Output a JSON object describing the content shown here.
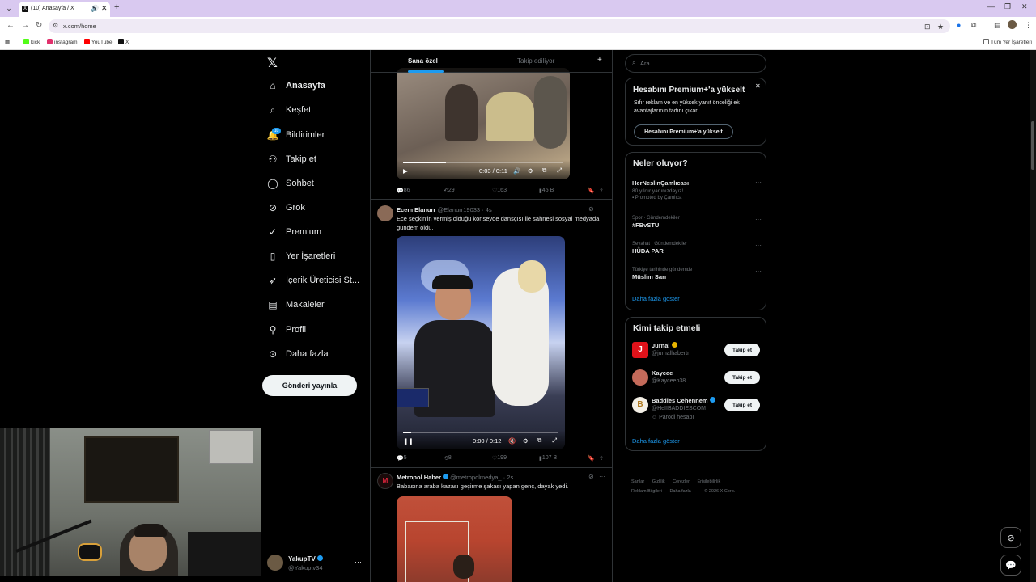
{
  "browser": {
    "tab_title": "(10) Anasayfa / X",
    "url": "x.com/home",
    "bookmarks": [
      "kick",
      "instagram",
      "YouTube",
      "X"
    ],
    "all_bookmarks": "Tüm Yer İşaretleri"
  },
  "nav": {
    "items": [
      {
        "label": "Anasayfa",
        "icon": "home-icon"
      },
      {
        "label": "Keşfet",
        "icon": "search-icon"
      },
      {
        "label": "Bildirimler",
        "icon": "bell-icon"
      },
      {
        "label": "Takip et",
        "icon": "follow-icon"
      },
      {
        "label": "Sohbet",
        "icon": "chat-icon"
      },
      {
        "label": "Grok",
        "icon": "grok-icon"
      },
      {
        "label": "Premium",
        "icon": "premium-icon"
      },
      {
        "label": "Yer İşaretleri",
        "icon": "bookmark-icon"
      },
      {
        "label": "İçerik Üreticisi St...",
        "icon": "rocket-icon"
      },
      {
        "label": "Makaleler",
        "icon": "article-icon"
      },
      {
        "label": "Profil",
        "icon": "person-icon"
      },
      {
        "label": "Daha fazla",
        "icon": "more-icon"
      }
    ],
    "notification_count": "10",
    "post_button": "Gönderi yayınla",
    "profile": {
      "name": "YakupTV",
      "handle": "@Yakuptv34"
    }
  },
  "feed": {
    "tabs": [
      "Sana özel",
      "Takip ediliyor"
    ],
    "tweet1": {
      "video_time": "0:03 / 0:11",
      "video_progress": 0.27,
      "replies": "86",
      "retweets": "29",
      "likes": "163",
      "views": "45 B"
    },
    "tweet2": {
      "name": "Ecem Elanurr",
      "handle": "@Elanurr19033",
      "time": "· 4s",
      "text": "Ece seçkin'in vermiş olduğu konseyde dansçısı ile sahnesi sosyal medyada gündem oldu.",
      "video_time": "0:00 / 0:12",
      "video_progress": 0.05,
      "replies": "5",
      "retweets": "8",
      "likes": "199",
      "views": "107 B"
    },
    "tweet3": {
      "name": "Metropol Haber",
      "handle": "@metropolmedya_",
      "time": "· 2s",
      "text": "Babasına araba kazası geçirme şakası yapan genç, dayak yedi."
    }
  },
  "sidebar": {
    "search_placeholder": "Ara",
    "premium": {
      "title": "Hesabını Premium+'a yükselt",
      "desc": "Sıfır reklam ve en yüksek yanıt önceliği ek avantajlarının tadını çıkar.",
      "button": "Hesabını Premium+'a yükselt"
    },
    "trends_title": "Neler oluyor?",
    "trends": [
      {
        "meta": "",
        "name": "HerNeslinÇamlıcası",
        "sub": "80 yıldır yanınızdayız!",
        "promo": "Promoted by Çamlıca"
      },
      {
        "meta": "Spor · Gündemdekiler",
        "name": "#FBvSTU"
      },
      {
        "meta": "Seyahat · Gündemdekiler",
        "name": "HÜDA PAR"
      },
      {
        "meta": "Türkiye tarihinde gündemde",
        "name": "Müslim Sarı"
      }
    ],
    "show_more": "Daha fazla göster",
    "wtf_title": "Kimi takip etmeli",
    "wtf": [
      {
        "name": "Jurnal",
        "handle": "@jurnalhabertr",
        "badge": "gold"
      },
      {
        "name": "Kaycee",
        "handle": "@Kayceep38",
        "badge": ""
      },
      {
        "name": "Baddies Cehennem",
        "handle": "@HeIIBADDIESCOM",
        "badge": "blue",
        "parody": "Parodi hesabı"
      }
    ],
    "follow_label": "Takip et",
    "footer": [
      "Şartlar",
      "Gizlilik",
      "Çerezler",
      "Erişilebilirlik",
      "Reklam Bilgileri",
      "Daha fazla ···",
      "© 2026 X Corp."
    ]
  },
  "colors": {
    "accent": "#1d9bf0",
    "background": "#000000",
    "text": "#e7e9ea",
    "muted": "#71767b"
  }
}
